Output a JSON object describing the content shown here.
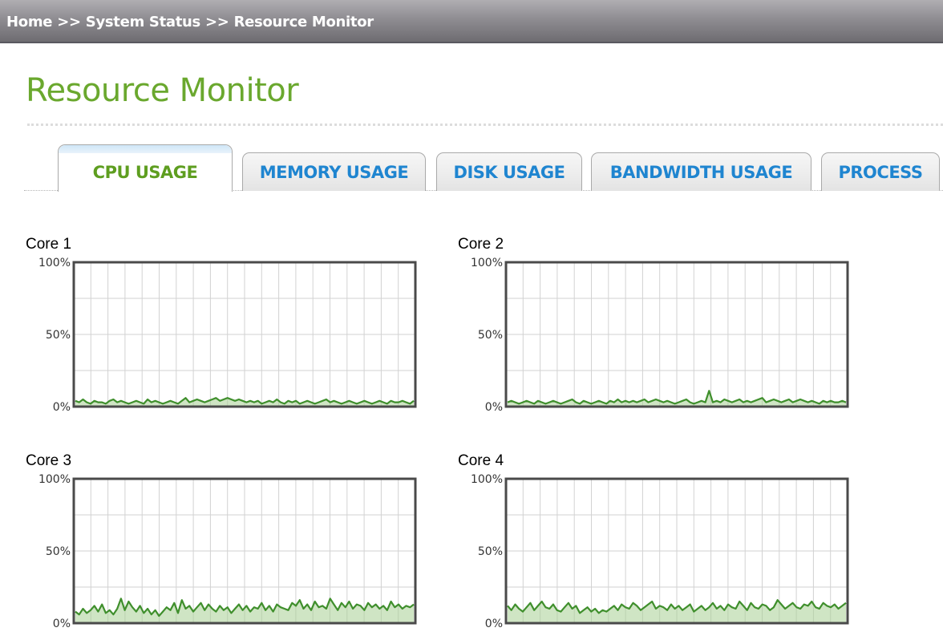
{
  "breadcrumb": {
    "items": [
      "Home",
      "System Status",
      "Resource Monitor"
    ],
    "separator": ">>"
  },
  "page": {
    "title": "Resource Monitor"
  },
  "tabs": [
    {
      "label": "CPU USAGE",
      "active": true
    },
    {
      "label": "MEMORY USAGE",
      "active": false
    },
    {
      "label": "DISK USAGE",
      "active": false
    },
    {
      "label": "BANDWIDTH USAGE",
      "active": false
    },
    {
      "label": "PROCESS",
      "active": false
    }
  ],
  "colors": {
    "accent_green": "#6aa82e",
    "tab_blue": "#1f85d0",
    "series_line": "#3f8f2c",
    "grid": "#d2d2d2",
    "frame": "#4a4a4a"
  },
  "chart_data": [
    {
      "type": "area",
      "title": "Core 1",
      "y_ticks": [
        "100%",
        "50%",
        "0%"
      ],
      "ylim": [
        0,
        100
      ],
      "grid": true,
      "values": [
        4,
        3,
        5,
        3,
        2,
        4,
        3,
        3,
        2,
        4,
        5,
        3,
        4,
        3,
        2,
        3,
        4,
        3,
        2,
        5,
        3,
        4,
        3,
        2,
        3,
        4,
        3,
        2,
        4,
        6,
        3,
        4,
        5,
        4,
        3,
        4,
        5,
        6,
        4,
        5,
        6,
        5,
        4,
        5,
        4,
        3,
        4,
        3,
        4,
        2,
        3,
        4,
        3,
        5,
        3,
        2,
        4,
        3,
        4,
        2,
        3,
        4,
        3,
        2,
        3,
        4,
        5,
        3,
        4,
        3,
        2,
        3,
        4,
        3,
        2,
        3,
        4,
        3,
        2,
        3,
        4,
        3,
        2,
        4,
        3,
        3,
        4,
        3,
        2,
        4
      ]
    },
    {
      "type": "area",
      "title": "Core 2",
      "y_ticks": [
        "100%",
        "50%",
        "0%"
      ],
      "ylim": [
        0,
        100
      ],
      "grid": true,
      "values": [
        3,
        4,
        3,
        2,
        3,
        4,
        3,
        2,
        4,
        3,
        2,
        3,
        4,
        3,
        2,
        3,
        4,
        5,
        3,
        2,
        4,
        3,
        2,
        3,
        4,
        3,
        2,
        4,
        3,
        5,
        3,
        4,
        3,
        4,
        3,
        4,
        5,
        3,
        4,
        5,
        4,
        3,
        4,
        3,
        2,
        3,
        4,
        5,
        3,
        2,
        3,
        4,
        3,
        11,
        3,
        4,
        3,
        5,
        4,
        3,
        4,
        5,
        3,
        4,
        3,
        4,
        5,
        6,
        3,
        4,
        5,
        4,
        3,
        4,
        5,
        3,
        4,
        5,
        4,
        3,
        4,
        3,
        2,
        4,
        3,
        4,
        3,
        3,
        4,
        3
      ]
    },
    {
      "type": "area",
      "title": "Core 3",
      "y_ticks": [
        "100%",
        "50%",
        "0%"
      ],
      "ylim": [
        0,
        100
      ],
      "grid": true,
      "values": [
        8,
        6,
        10,
        7,
        9,
        12,
        8,
        13,
        7,
        9,
        6,
        10,
        17,
        9,
        15,
        11,
        8,
        12,
        7,
        10,
        6,
        9,
        5,
        8,
        11,
        9,
        14,
        7,
        16,
        10,
        12,
        8,
        11,
        14,
        9,
        13,
        10,
        8,
        12,
        9,
        11,
        7,
        10,
        13,
        9,
        12,
        8,
        11,
        10,
        14,
        9,
        12,
        8,
        13,
        11,
        10,
        9,
        14,
        12,
        16,
        10,
        13,
        9,
        15,
        11,
        12,
        10,
        17,
        13,
        9,
        14,
        11,
        15,
        10,
        13,
        12,
        9,
        14,
        11,
        13,
        10,
        12,
        9,
        15,
        11,
        13,
        10,
        12,
        11,
        13
      ]
    },
    {
      "type": "area",
      "title": "Core 4",
      "y_ticks": [
        "100%",
        "50%",
        "0%"
      ],
      "ylim": [
        0,
        100
      ],
      "grid": true,
      "values": [
        12,
        9,
        13,
        10,
        8,
        11,
        14,
        9,
        12,
        15,
        11,
        10,
        13,
        9,
        8,
        11,
        14,
        10,
        12,
        7,
        9,
        11,
        8,
        10,
        7,
        9,
        8,
        10,
        12,
        9,
        13,
        11,
        10,
        14,
        12,
        9,
        11,
        13,
        15,
        10,
        12,
        11,
        9,
        13,
        10,
        12,
        9,
        11,
        13,
        8,
        10,
        12,
        9,
        11,
        14,
        10,
        12,
        9,
        13,
        11,
        10,
        15,
        12,
        9,
        14,
        11,
        10,
        13,
        12,
        9,
        11,
        16,
        13,
        10,
        12,
        14,
        11,
        10,
        13,
        12,
        15,
        11,
        10,
        14,
        12,
        11,
        13,
        10,
        12,
        14
      ]
    }
  ]
}
